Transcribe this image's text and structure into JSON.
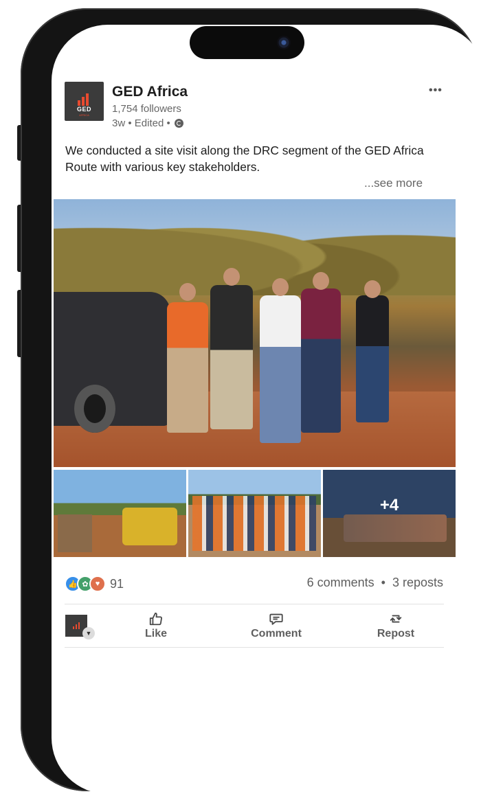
{
  "post": {
    "company": "GED Africa",
    "logo_text": "GED",
    "logo_sub": "AFRICA",
    "followers": "1,754 followers",
    "meta": "3w • Edited •",
    "more_menu": "•••",
    "text": "We conducted a site visit along the DRC segment of the GED Africa Route with various key stakeholders.",
    "see_more": "...see more"
  },
  "media": {
    "extra_count": "+4"
  },
  "social": {
    "reaction_count": "91",
    "comments": "6 comments",
    "separator": "•",
    "reposts": "3 reposts",
    "reactions": [
      "like",
      "celebrate",
      "love"
    ]
  },
  "actions": {
    "like": "Like",
    "comment": "Comment",
    "repost": "Repost"
  },
  "colors": {
    "accent": "#e84a2f",
    "like": "#378fe9",
    "celebrate": "#44a06a",
    "love": "#df704d"
  }
}
